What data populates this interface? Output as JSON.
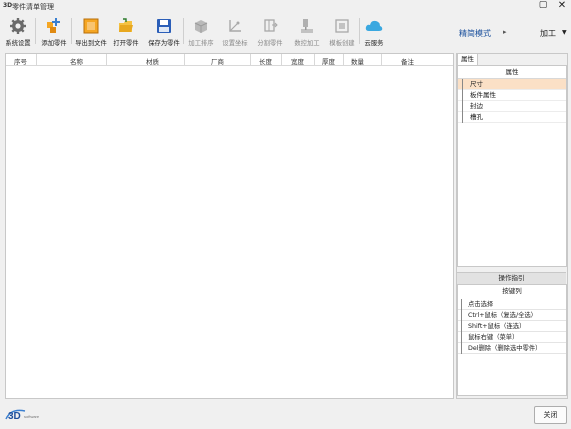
{
  "window": {
    "title": "零件清单管理",
    "app_icon": "3D"
  },
  "toolbar": {
    "buttons": [
      {
        "label": "系统设置",
        "icon": "gear-icon",
        "enabled": true
      },
      {
        "label": "添加零件",
        "icon": "add-part-icon",
        "enabled": true
      },
      {
        "label": "导出到文件",
        "icon": "export-box-icon",
        "enabled": true
      },
      {
        "label": "打开零件",
        "icon": "open-folder-icon",
        "enabled": true
      },
      {
        "label": "保存为零件",
        "icon": "save-icon",
        "enabled": true
      },
      {
        "label": "加工排序",
        "icon": "process-order-icon",
        "enabled": false
      },
      {
        "label": "设置坐标",
        "icon": "coordinate-icon",
        "enabled": false
      },
      {
        "label": "分割零件",
        "icon": "split-icon",
        "enabled": false
      },
      {
        "label": "数控加工",
        "icon": "cnc-icon",
        "enabled": false
      },
      {
        "label": "模板创建",
        "icon": "template-icon",
        "enabled": false
      },
      {
        "label": "云服务",
        "icon": "cloud-icon",
        "enabled": true
      }
    ],
    "mode_link": "精简模式",
    "process_dropdown": "加工"
  },
  "table": {
    "columns": [
      "序号",
      "名称",
      "材质",
      "厂商",
      "长度",
      "宽度",
      "厚度",
      "数量",
      "备注"
    ]
  },
  "right_panel": {
    "tab": "属性",
    "attr_header": "属性",
    "attr_rows": [
      {
        "label": "尺寸",
        "selected": true
      },
      {
        "label": "板件属性",
        "selected": false
      },
      {
        "label": "封边",
        "selected": false
      },
      {
        "label": "槽孔",
        "selected": false
      }
    ],
    "guide_header": "操作指引",
    "guide_subheader": "按键列",
    "guide_rows": [
      "点击选择",
      "Ctrl+鼠标（复选/全选）",
      "Shift+鼠标（连选）",
      "鼠标右键（菜单）",
      "Del删除（删除选中零件）"
    ]
  },
  "footer": {
    "logo_text": "3D",
    "logo_sub": "software",
    "close_label": "关闭"
  },
  "colors": {
    "selected_row": "#fbe0c6",
    "link": "#1a4f9c",
    "orange": "#f5a623",
    "cloud": "#3aa8e0"
  }
}
